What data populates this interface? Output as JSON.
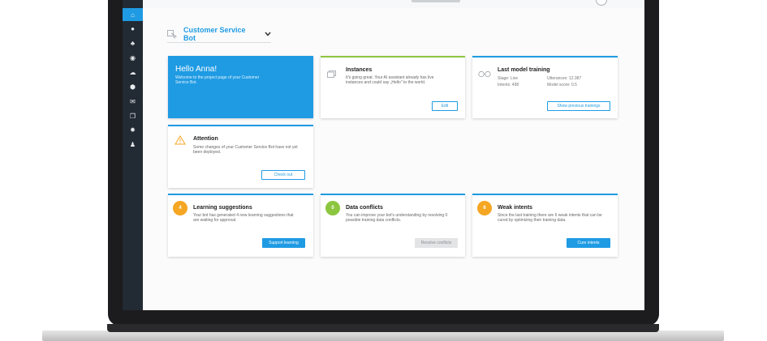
{
  "project": {
    "name": "Customer Service Bot"
  },
  "sidebar": {
    "items": [
      {
        "icon": "home-icon",
        "glyph": "⌂",
        "active": true
      },
      {
        "icon": "chat-icon",
        "glyph": "●"
      },
      {
        "icon": "users-icon",
        "glyph": "♣"
      },
      {
        "icon": "intents-icon",
        "glyph": "◉"
      },
      {
        "icon": "cloud-icon",
        "glyph": "☁"
      },
      {
        "icon": "entities-icon",
        "glyph": "⬢"
      },
      {
        "icon": "mail-icon",
        "glyph": "✉"
      },
      {
        "icon": "copy-icon",
        "glyph": "❐"
      },
      {
        "icon": "gear-icon",
        "glyph": "✹"
      },
      {
        "icon": "user-icon",
        "glyph": "♟"
      }
    ]
  },
  "hello": {
    "title": "Hello Anna!",
    "text": "Welcome to the project page of your Customer Service Bot."
  },
  "instances": {
    "title": "Instances",
    "text": "It's going great. Your AI assistant already has live instances and could say „Hello\" to the world.",
    "button": "Edit",
    "accent": "#8cc63f"
  },
  "training": {
    "title": "Last model training",
    "stage": "Stage: Live",
    "intents": "Intents: 498",
    "utterances": "Utterances: 12.387",
    "model_score": "Model score: 0.5",
    "button": "Show previous trainings"
  },
  "attention": {
    "title": "Attention",
    "text": "Some changes of your Customer Service Bot have not yet been deployed.",
    "button": "Check out"
  },
  "learning": {
    "badge": "4",
    "badge_color": "#f5a623",
    "title": "Learning suggestions",
    "text": "Your bot has generated 4 new learning suggestions that are waiting for approval.",
    "button": "Support learning"
  },
  "conflicts": {
    "badge": "0",
    "badge_color": "#8cc63f",
    "title": "Data conflicts",
    "text": "You can improve your bot's understanding by resolving 0 possible training data conflicts.",
    "button": "Resolve conflicts"
  },
  "weak": {
    "badge": "6",
    "badge_color": "#f5a623",
    "title": "Weak intents",
    "text": "Since the last training there are 6 weak intents that can be cured by optimizing their training data.",
    "button": "Cure intents"
  },
  "colors": {
    "accent": "#1f9be3",
    "sidebar": "#222a33"
  }
}
